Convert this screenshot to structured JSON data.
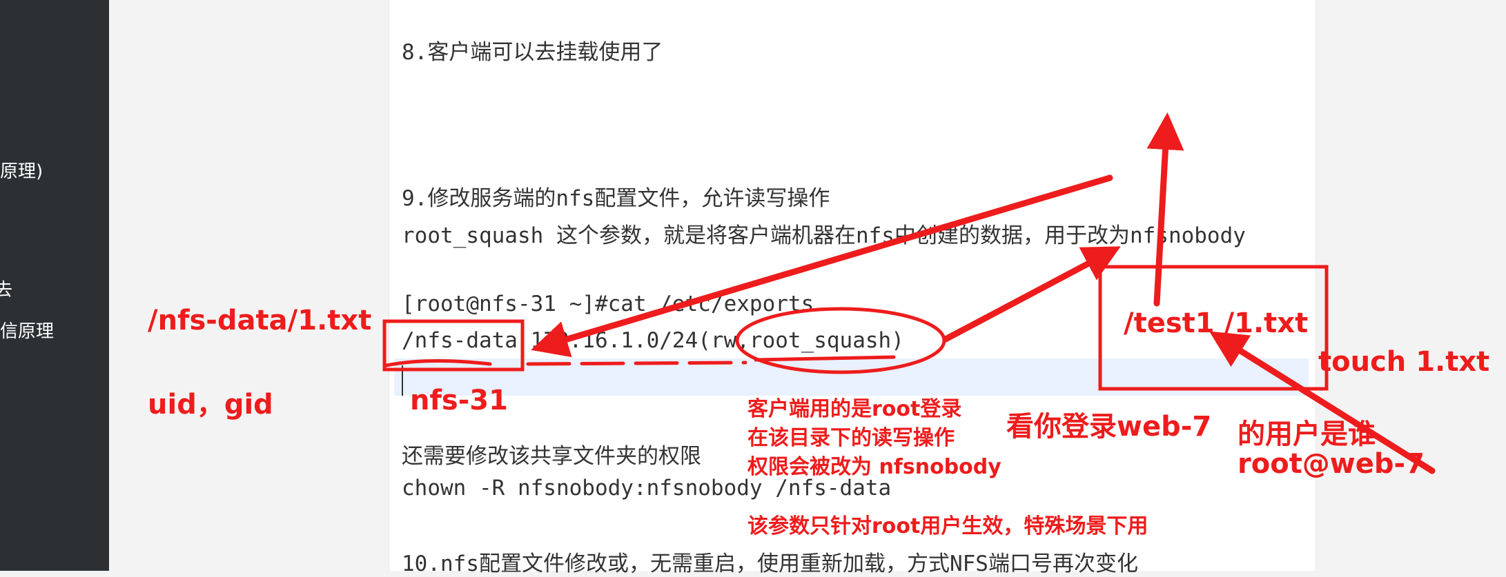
{
  "sidebar": {
    "items": [
      "原理)",
      "去",
      "信原理"
    ]
  },
  "document": {
    "lines": [
      "8.客户端可以去挂载使用了",
      "9.修改服务端的nfs配置文件，允许读写操作",
      "root_squash 这个参数，就是将客户端机器在nfs中创建的数据，用于改为nfsnobody",
      "[root@nfs-31 ~]#cat /etc/exports",
      "/nfs-data  172.16.1.0/24(rw,root_squash)",
      "还需要修改该共享文件夹的权限",
      "chown -R nfsnobody:nfsnobody  /nfs-data",
      "10.nfs配置文件修改或，无需重启，使用重新加载，方式NFS端口号再次变化"
    ]
  },
  "annotations": {
    "nfs_path": "/nfs-data/1.txt",
    "uid_gid": "uid，gid",
    "nfs31": "nfs-31",
    "client_note_1": "客户端用的是root登录",
    "client_note_2": "在该目录下的读写操作",
    "client_note_3": "权限会被改为 nfsnobody",
    "scope_note": "该参数只针对root用户生效，特殊场景下用",
    "web7_login": "看你登录web-7",
    "test_path": "/test1 /1.txt",
    "touch": "touch 1.txt",
    "user_is": "的用户是谁",
    "root_web7": "root@web-7"
  },
  "colors": {
    "annotation": "#ee1c1c",
    "sidebar": "#2c3033",
    "text": "#333333",
    "highlight": "#e8f1fd"
  }
}
